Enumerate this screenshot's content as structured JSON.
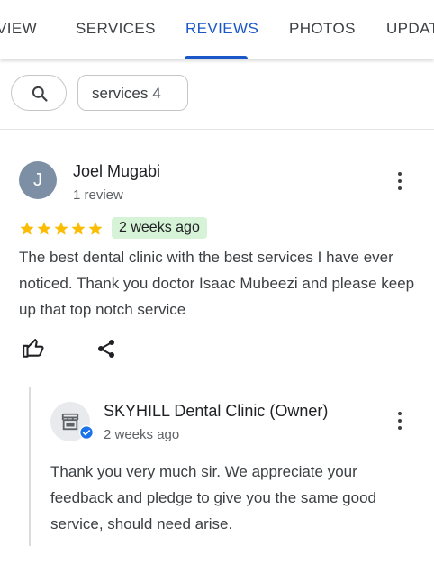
{
  "tabs": [
    {
      "label": "VIEW",
      "active": false
    },
    {
      "label": "SERVICES",
      "active": false
    },
    {
      "label": "REVIEWS",
      "active": true
    },
    {
      "label": "PHOTOS",
      "active": false
    },
    {
      "label": "UPDAT",
      "active": false
    }
  ],
  "filters": {
    "search_icon": "search-icon",
    "chip_label": "services",
    "chip_count": "4"
  },
  "review": {
    "avatar_letter": "J",
    "name": "Joel Mugabi",
    "meta": "1 review",
    "rating": 5,
    "rating_max": 5,
    "date": "2 weeks ago",
    "text": "The best dental clinic with the best services I have ever noticed. Thank you doctor Isaac Mubeezi and please keep up that top notch service",
    "actions": [
      "thumbs-up-icon",
      "share-icon"
    ]
  },
  "reply": {
    "name": "SKYHILL Dental Clinic (Owner)",
    "date": "2 weeks ago",
    "text": "Thank you very much sir. We appreciate your feedback and pledge to give you the same good service, should need arise."
  },
  "colors": {
    "accent": "#1a57c9",
    "star": "#fbbc04",
    "date_badge_bg": "#d6f3d7",
    "avatar_bg": "#7d8fa4"
  }
}
